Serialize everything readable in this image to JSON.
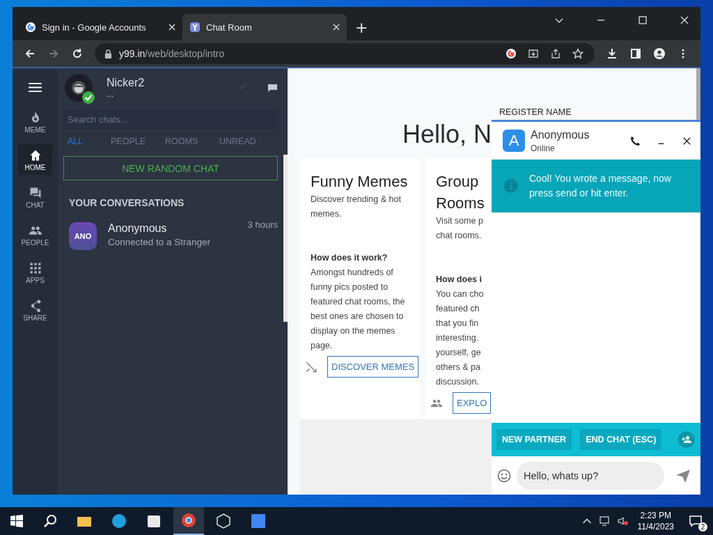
{
  "browser": {
    "tabs": [
      {
        "title": "Sign in - Google Accounts",
        "selected": false
      },
      {
        "title": "Chat Room",
        "selected": true
      }
    ],
    "new_tab": "+",
    "nav": {
      "back_disabled": false,
      "forward_disabled": true
    },
    "address": {
      "host": "y99.in",
      "path": "/web/desktop/intro"
    }
  },
  "app_nav": [
    {
      "label": "MEME",
      "selected": false
    },
    {
      "label": "HOME",
      "selected": true
    },
    {
      "label": "CHAT",
      "selected": false
    },
    {
      "label": "PEOPLE",
      "selected": false
    },
    {
      "label": "APPS",
      "selected": false
    },
    {
      "label": "SHARE",
      "selected": false
    }
  ],
  "profile": {
    "name": "Nicker2",
    "status": "...",
    "online": true
  },
  "search": {
    "placeholder": "Search chats..."
  },
  "filters": [
    {
      "label": "ALL",
      "selected": true
    },
    {
      "label": "PEOPLE",
      "selected": false
    },
    {
      "label": "ROOMS",
      "selected": false
    },
    {
      "label": "UNREAD",
      "selected": false
    }
  ],
  "new_chat_button": "NEW RANDOM CHAT",
  "conversations_heading": "YOUR CONVERSATIONS",
  "conversations": [
    {
      "avatar": "ANO",
      "name": "Anonymous",
      "preview": "Connected to a Stranger",
      "time": "3 hours"
    }
  ],
  "greeting": "Hello, N",
  "cards": [
    {
      "title": "Funny Memes",
      "description": "Discover trending & hot memes.",
      "how_heading": "How does it work?",
      "how_text": "Amongst hundreds of funny pics posted to featured chat rooms, the best ones are chosen to display on the memes page.",
      "button": "DISCOVER MEMES"
    }
  ],
  "cut_card": {
    "title_lines": [
      "Group",
      "Rooms"
    ],
    "description_lines": [
      "Visit some p",
      "chat rooms."
    ],
    "how_lines": [
      "How does i"
    ],
    "text_lines": [
      "You can cho",
      "featured ch",
      "that you fin",
      "interesting.",
      "yourself, ge",
      "others & pa",
      "discussion."
    ],
    "button": "EXPLO"
  },
  "register_link": "REGISTER NAME",
  "chat": {
    "avatar": "A",
    "name": "Anonymous",
    "status": "Online",
    "notice": "Cool! You wrote a message, now press send or hit enter.",
    "actions": [
      "NEW PARTNER",
      "END CHAT (ESC)"
    ],
    "input_value": "Hello, whats up?"
  },
  "taskbar": {
    "apps": [
      {
        "selected": false
      },
      {
        "selected": false
      },
      {
        "selected": false
      },
      {
        "selected": true
      },
      {
        "selected": false
      },
      {
        "selected": false
      }
    ],
    "time": "2:23 PM",
    "date": "11/4/2023",
    "notifications": "2"
  }
}
